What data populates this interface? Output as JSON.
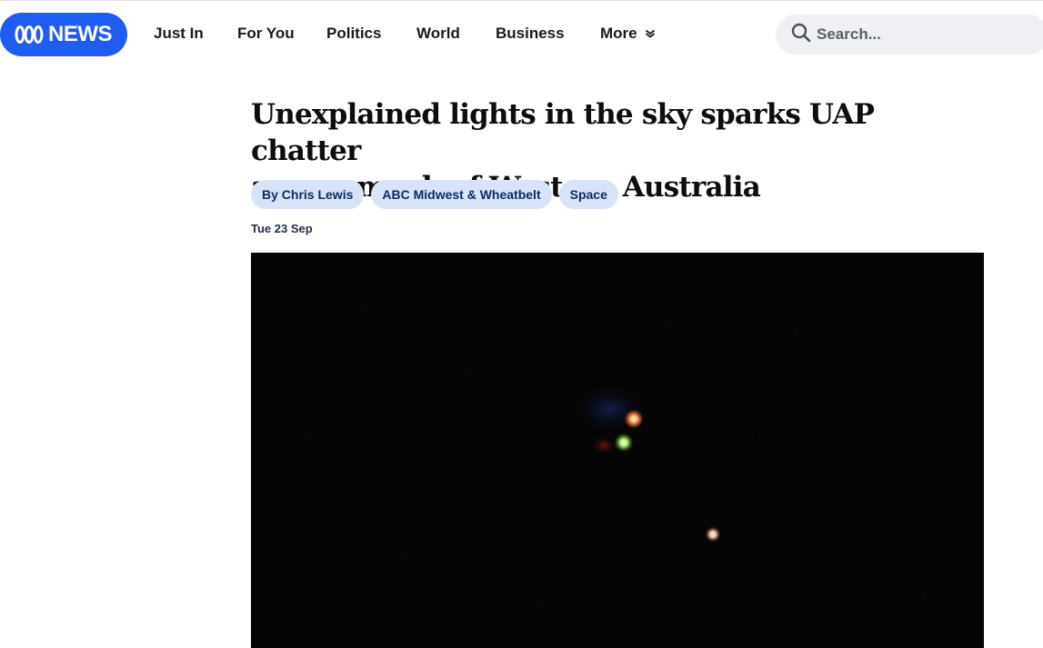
{
  "brand": {
    "logo_text": "NEWS",
    "color": "#1f5cf2"
  },
  "nav": {
    "items": [
      "Just In",
      "For You",
      "Politics",
      "World",
      "Business"
    ],
    "more_label": "More"
  },
  "search": {
    "placeholder": "Search..."
  },
  "article": {
    "headline_line1": "Unexplained lights in the sky sparks UAP chatter",
    "headline_line2": "across much of Western Australia",
    "tags": [
      "By Chris Lewis",
      "ABC Midwest & Wheatbelt",
      "Space"
    ],
    "date": "Tue 23 Sep"
  },
  "icons": {
    "logo": "abc-lissajous-icon",
    "more": "chevron-down-icon",
    "search": "search-icon"
  },
  "colors": {
    "tag_bg": "#d7e4f7",
    "tag_text": "#0b2a5e",
    "search_bg": "#eef0f3",
    "hero_bg": "#050505"
  }
}
